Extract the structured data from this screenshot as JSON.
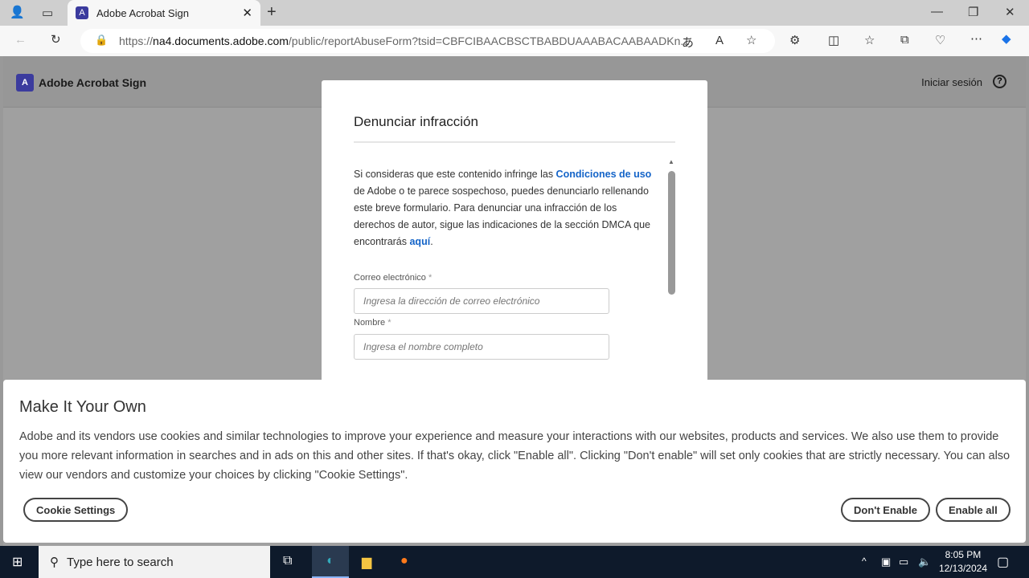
{
  "browser": {
    "tab_title": "Adobe Acrobat Sign",
    "url_prefix": "https://",
    "url_host": "na4.documents.adobe.com",
    "url_path": "/public/reportAbuseForm?tsid=CBFCIBAACBSCTBABDUAAABACAABAADKn..."
  },
  "header": {
    "brand": "Adobe Acrobat Sign",
    "signin": "Iniciar sesión",
    "help": "?"
  },
  "modal": {
    "title": "Denunciar infracción",
    "text_1": "Si consideras que este contenido infringe las ",
    "link_terms": "Condiciones de uso",
    "text_2": " de Adobe o te parece sospechoso, puedes denunciarlo rellenando este breve formulario. Para denunciar una infracción de los derechos de autor, sigue las indicaciones de la sección DMCA que encontrarás ",
    "link_here": "aquí",
    "text_3": ".",
    "email_label": "Correo electrónico",
    "email_placeholder": "Ingresa la dirección de correo electrónico",
    "name_label": "Nombre",
    "name_placeholder": "Ingresa el nombre completo",
    "required": "*"
  },
  "cookie": {
    "title": "Make It Your Own",
    "text": "Adobe and its vendors use cookies and similar technologies to improve your experience and measure your interactions with our websites, products and services. We also use them to provide you more relevant information in searches and in ads on this and other sites. If that's okay, click \"Enable all\". Clicking \"Don't enable\" will set only cookies that are strictly necessary. You can also view our vendors and customize your choices by clicking \"Cookie Settings\".",
    "settings": "Cookie Settings",
    "dont_enable": "Don't Enable",
    "enable_all": "Enable all"
  },
  "taskbar": {
    "search_placeholder": "Type here to search",
    "time": "8:05 PM",
    "date": "12/13/2024"
  }
}
